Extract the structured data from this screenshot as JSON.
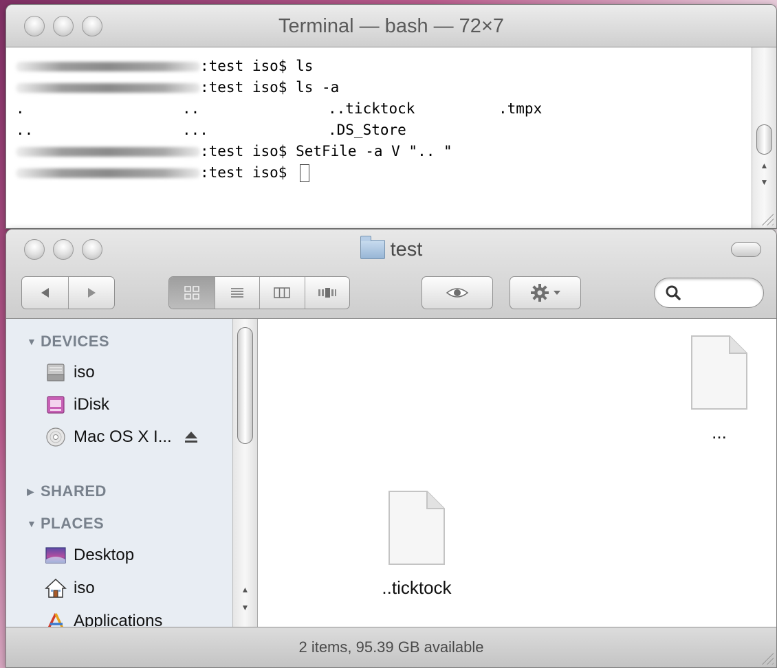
{
  "terminal": {
    "title": "Terminal — bash — 72×7",
    "lines": {
      "l1": ":test iso$ ls",
      "l2": ":test iso$ ls -a",
      "l3": {
        "c1": ".",
        "c2": "..",
        "c3": "..ticktock",
        "c4": ".tmpx"
      },
      "l4": {
        "c1": "..",
        "c2": "...",
        "c3": ".DS_Store"
      },
      "l5": ":test iso$ SetFile -a V \".. \"",
      "l6": ":test iso$ "
    }
  },
  "finder": {
    "title": "test",
    "search": {
      "placeholder": ""
    },
    "sidebar": {
      "devices_header": "DEVICES",
      "shared_header": "SHARED",
      "places_header": "PLACES",
      "devices": [
        "iso",
        "iDisk",
        "Mac OS X I..."
      ],
      "places": [
        "Desktop",
        "iso",
        "Applications"
      ]
    },
    "files": [
      "...",
      "..ticktock"
    ],
    "status": "2 items, 95.39 GB available"
  },
  "colors": {
    "sidebar_bg": "#e8edf3",
    "header_text": "#78818c",
    "window_chrome": "#d6d6d6"
  }
}
